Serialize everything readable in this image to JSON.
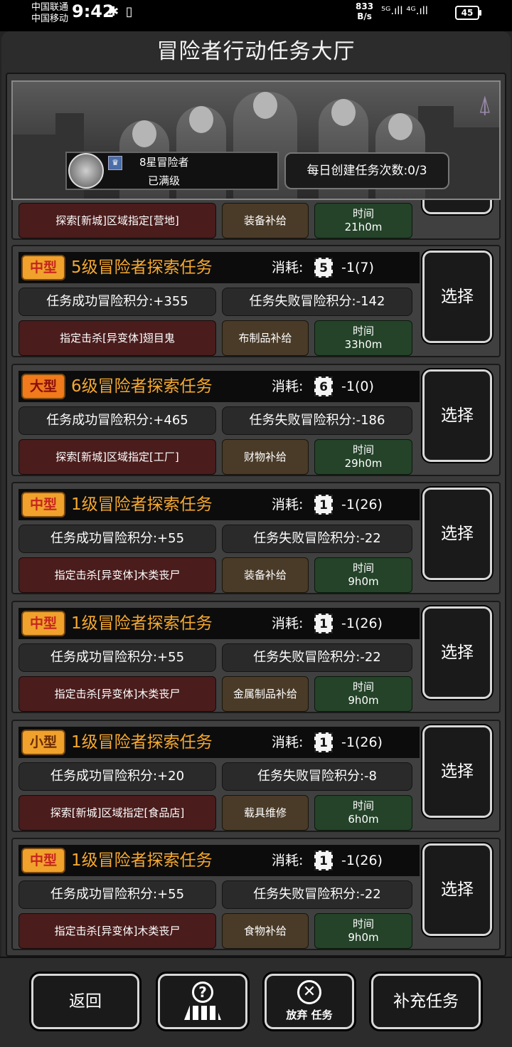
{
  "status_bar": {
    "carrier_1": "中国联通",
    "carrier_2": "中国移动",
    "time": "9:42",
    "net_speed_value": "833",
    "net_speed_unit": "B/s",
    "signal_text": "⁵ᴳ.ıll ⁴ᴳ.ıll",
    "battery": "45"
  },
  "header": {
    "title": "冒险者行动任务大厅"
  },
  "banner": {
    "rank": "8星冒险者",
    "level_status": "已满级",
    "daily_quota": "每日创建任务次数:0/3"
  },
  "partial_card": {
    "objective": "探索[新城]区域指定[营地]",
    "supply": "装备补给",
    "time_label": "时间",
    "time_value": "21h0m"
  },
  "tasks": [
    {
      "size": "中型",
      "title": "5级冒险者探索任务",
      "cost_label": "消耗:",
      "cost_level": "5",
      "cost_value": "-1(7)",
      "success": "任务成功冒险积分:+355",
      "fail": "任务失败冒险积分:-142",
      "objective": "指定击杀[异变体]翅目鬼",
      "supply": "布制品补给",
      "time_label": "时间",
      "time_value": "33h0m",
      "button": "选择"
    },
    {
      "size": "大型",
      "title": "6级冒险者探索任务",
      "cost_label": "消耗:",
      "cost_level": "6",
      "cost_value": "-1(0)",
      "success": "任务成功冒险积分:+465",
      "fail": "任务失败冒险积分:-186",
      "objective": "探索[新城]区域指定[工厂]",
      "supply": "财物补给",
      "time_label": "时间",
      "time_value": "29h0m",
      "button": "选择"
    },
    {
      "size": "中型",
      "title": "1级冒险者探索任务",
      "cost_label": "消耗:",
      "cost_level": "1",
      "cost_value": "-1(26)",
      "success": "任务成功冒险积分:+55",
      "fail": "任务失败冒险积分:-22",
      "objective": "指定击杀[异变体]木类丧尸",
      "supply": "装备补给",
      "time_label": "时间",
      "time_value": "9h0m",
      "button": "选择"
    },
    {
      "size": "中型",
      "title": "1级冒险者探索任务",
      "cost_label": "消耗:",
      "cost_level": "1",
      "cost_value": "-1(26)",
      "success": "任务成功冒险积分:+55",
      "fail": "任务失败冒险积分:-22",
      "objective": "指定击杀[异变体]木类丧尸",
      "supply": "金属制品补给",
      "time_label": "时间",
      "time_value": "9h0m",
      "button": "选择"
    },
    {
      "size": "小型",
      "title": "1级冒险者探索任务",
      "cost_label": "消耗:",
      "cost_level": "1",
      "cost_value": "-1(26)",
      "success": "任务成功冒险积分:+20",
      "fail": "任务失败冒险积分:-8",
      "objective": "探索[新城]区域指定[食品店]",
      "supply": "载具维修",
      "time_label": "时间",
      "time_value": "6h0m",
      "button": "选择"
    },
    {
      "size": "中型",
      "title": "1级冒险者探索任务",
      "cost_label": "消耗:",
      "cost_level": "1",
      "cost_value": "-1(26)",
      "success": "任务成功冒险积分:+55",
      "fail": "任务失败冒险积分:-22",
      "objective": "指定击杀[异变体]木类丧尸",
      "supply": "食物补给",
      "time_label": "时间",
      "time_value": "9h0m",
      "button": "选择"
    }
  ],
  "bottom_bar": {
    "back": "返回",
    "help_icon": "question-map-icon",
    "abandon": "放弃 任务",
    "refill": "补充任务"
  }
}
